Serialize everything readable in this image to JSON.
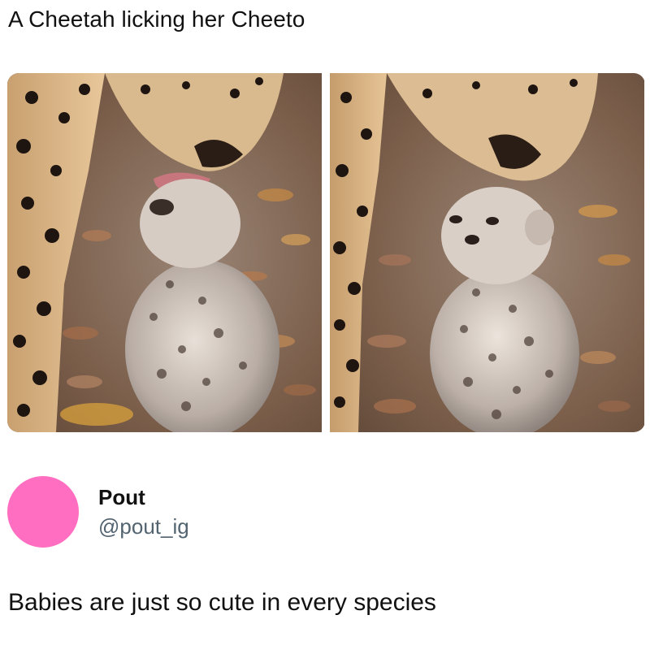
{
  "post": {
    "title": "A Cheetah licking her Cheeto",
    "images": [
      {
        "alt_icon": "cheetah-licking-cub-photo"
      },
      {
        "alt_icon": "cheetah-cub-photo"
      }
    ]
  },
  "author": {
    "display_name": "Pout",
    "handle": "@pout_ig",
    "avatar_color": "#ff6ec1"
  },
  "tweet": {
    "text": "Babies are just so cute in every species"
  },
  "colors": {
    "text": "#111111",
    "handle": "#536471"
  }
}
